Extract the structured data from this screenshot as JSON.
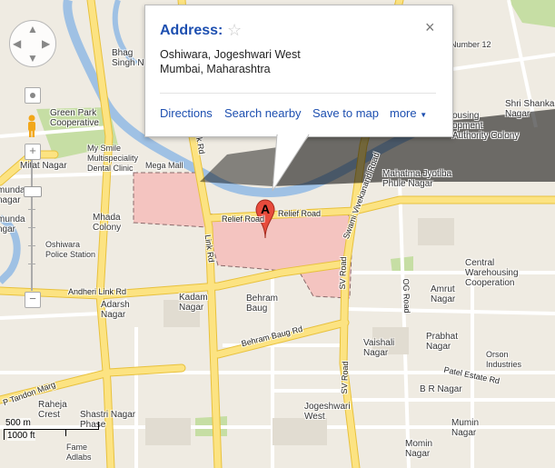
{
  "map": {
    "marker_letter": "A",
    "scale": {
      "metric": "500 m",
      "imperial": "1000 ft"
    },
    "roads": [
      {
        "name": "Relief Road",
        "key": "relief_road_1"
      },
      {
        "name": "Relief Road",
        "key": "relief_road_2"
      },
      {
        "name": "Link Rd",
        "key": "link_rd_1"
      },
      {
        "name": "Link Rd",
        "key": "link_rd_2"
      },
      {
        "name": "Andheri Link Rd",
        "key": "andheri_link_rd"
      },
      {
        "name": "Behram Baug Rd",
        "key": "behram_baug_rd"
      },
      {
        "name": "SV Road",
        "key": "sv_road_1"
      },
      {
        "name": "SV Road",
        "key": "sv_road_2"
      },
      {
        "name": "Swami Vivekanand Road",
        "key": "swami_vivekanand_road"
      },
      {
        "name": "OG Road",
        "key": "og_road"
      },
      {
        "name": "P Tandon Marg",
        "key": "p_tandon_marg"
      },
      {
        "name": "Patel Estate Rd",
        "key": "patel_estate_rd"
      }
    ],
    "places": {
      "bhagat_singh": "Bhag\nSingh N",
      "green_park": "Green Park\nCooperative",
      "mitat_nagar": "Mitat Nagar",
      "my_smile": "My Smile\nMultispeciality\nDental Clinic",
      "mega_mall": "Mega Mall",
      "mhada_colony": "Mhada\nColony",
      "oshiwara_police": "Oshiwara\nPolice Station",
      "jamuna_1": "munda\nnagar",
      "jamuna_2": "munda\nngar",
      "kadam_nagar": "Kadam\nNagar",
      "adarsh_nagar": "Adarsh\nNagar",
      "behram_baug": "Behram\nBaug",
      "mahatma": "Mahatma Jyotiba\nPhule Nagar",
      "ousing": "ousing\nopment\nAuthority Colony",
      "shri_shankar": "Shri Shankar\nNagar",
      "number_12": "Number 12",
      "central_warehousing": "Central\nWarehousing\nCooperation",
      "amrut_nagar": "Amrut\nNagar",
      "prabhat_nagar": "Prabhat\nNagar",
      "vaishali_nagar": "Vaishali\nNagar",
      "orson_industries": "Orson\nIndustries",
      "b_r_nagar": "B R Nagar",
      "jogeshwari_west": "Jogeshwari\nWest",
      "mumin_nagar": "Mumin\nNagar",
      "momin_nagar": "Momin\nNagar",
      "raheja_crest": "Raheja\nCrest",
      "shastri_nagar": "Shastri Nagar\nPhase",
      "fame_adlabs": "Fame\nAdlabs"
    }
  },
  "info_window": {
    "title": "Address:",
    "address_line1": "Oshiwara, Jogeshwari West",
    "address_line2": "Mumbai, Maharashtra",
    "links": {
      "directions": "Directions",
      "search_nearby": "Search nearby",
      "save_to_map": "Save to map",
      "more": "more"
    },
    "close_glyph": "×",
    "star_glyph": "☆"
  },
  "controls": {
    "pan_arrows": [
      "▲",
      "▼",
      "◀",
      "▶"
    ],
    "zoom_in": "+",
    "zoom_out": "−"
  },
  "colors": {
    "highlight_fill": "#f4c4c0",
    "highlight_stroke": "#8a6a6a",
    "major_road": "#fce382",
    "major_road_stroke": "#e8c13c",
    "water": "#9fc1e4",
    "park": "#c6dea4",
    "link": "#1d4fb0"
  }
}
